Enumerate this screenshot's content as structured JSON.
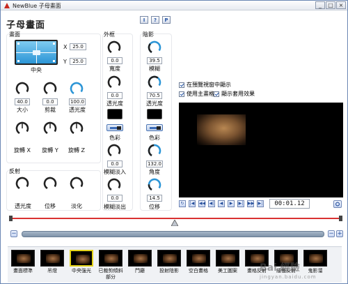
{
  "window": {
    "title": "NewBlue 子母畫面",
    "controls": [
      "_",
      "□",
      "×"
    ]
  },
  "page_title": "子母畫面",
  "top_tools": [
    "I",
    "?",
    "P"
  ],
  "stage": {
    "title": "畫面",
    "x_label": "X",
    "x_value": "25.0",
    "y_label": "Y",
    "y_value": "25.0",
    "position_label": "中央",
    "knobs": [
      {
        "value": "40.0",
        "label": "大小"
      },
      {
        "value": "0.0",
        "label": "剪裁"
      },
      {
        "value": "100.0",
        "label": "透光度"
      }
    ],
    "rotate_knobs": [
      {
        "label": "旋轉 X"
      },
      {
        "label": "旋轉 Y"
      },
      {
        "label": "旋轉 Z"
      }
    ]
  },
  "reflection": {
    "title": "反射",
    "knobs": [
      {
        "label": "透光度"
      },
      {
        "label": "位移"
      },
      {
        "label": "淡化"
      }
    ]
  },
  "border": {
    "title": "外框",
    "knobs": [
      {
        "value": "0.0",
        "label": "寬度"
      },
      {
        "value": "0.0",
        "label": "透光度"
      }
    ],
    "color_label": "色彩",
    "knobs2": [
      {
        "value": "0.0",
        "label": "模糊淡入"
      },
      {
        "value": "0.0",
        "label": "模糊淡出"
      }
    ]
  },
  "shadow": {
    "title": "陰影",
    "knobs": [
      {
        "value": "39.5",
        "label": "模糊"
      },
      {
        "value": "70.5",
        "label": "透光度"
      }
    ],
    "color_label": "色彩",
    "knobs2": [
      {
        "value": "132.0",
        "label": "角度"
      },
      {
        "value": "14.5",
        "label": "位移"
      }
    ]
  },
  "options": [
    {
      "label": "在預覽視窗中顯示",
      "checked": true
    },
    {
      "label": "使用主畫格",
      "checked": true
    },
    {
      "label": "顯示套用效果",
      "checked": true
    }
  ],
  "transport": {
    "buttons": [
      "↻",
      "|◀",
      "◀◀",
      "◀|",
      "◀",
      "▶",
      "▶|",
      "▶▶",
      "▶|"
    ],
    "timecode": "00:01.12"
  },
  "presets": [
    {
      "name": "畫面標準"
    },
    {
      "name": "吊燈"
    },
    {
      "name": "中央強光",
      "selected": true
    },
    {
      "name": "已裁剪傾斜部分"
    },
    {
      "name": "門廳"
    },
    {
      "name": "投射陰影"
    },
    {
      "name": "空白畫格"
    },
    {
      "name": "美工圖案"
    },
    {
      "name": "畫格反射"
    },
    {
      "name": "緩慢反射"
    },
    {
      "name": "鬼影溜"
    }
  ],
  "watermark": {
    "text": "Bai 經驗",
    "sub": "jingyan.baidu.com"
  },
  "colors": {
    "accent": "#2c95d6",
    "timeline": "#d93232",
    "selected": "#e3d21a"
  }
}
